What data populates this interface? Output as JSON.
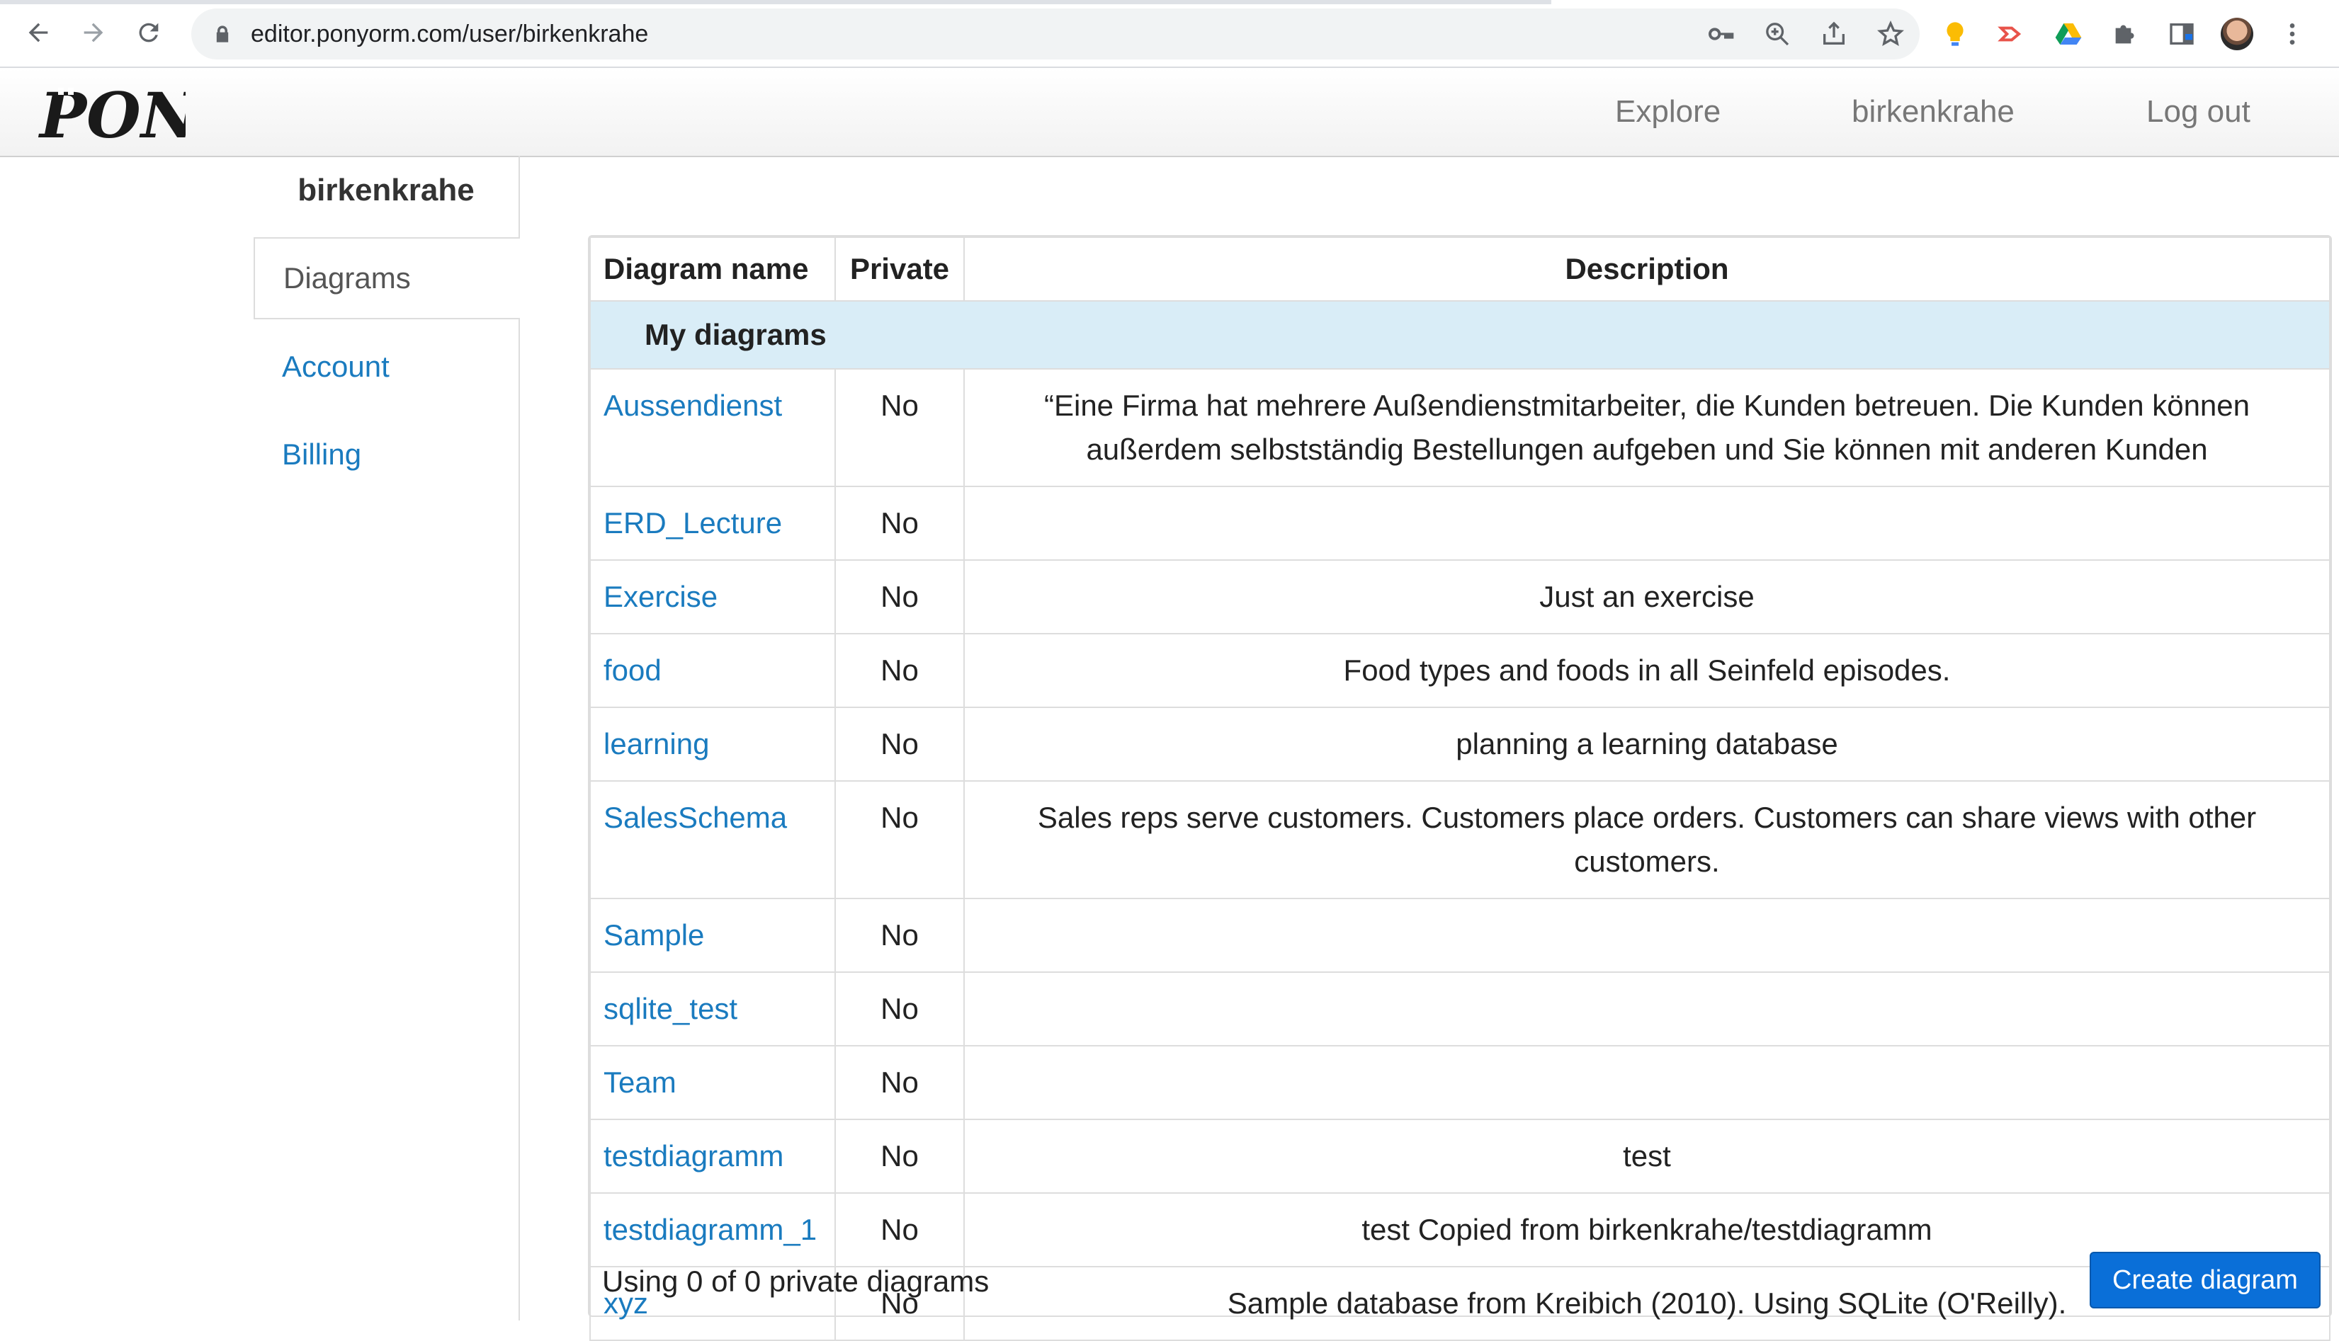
{
  "browser": {
    "url": "editor.ponyorm.com/user/birkenkrahe",
    "toolbar_icons": [
      "back-icon",
      "forward-icon",
      "reload-icon"
    ],
    "omnibox_icons": [
      "key-icon",
      "zoom-icon",
      "share-icon",
      "star-icon"
    ],
    "extension_icons": [
      "lightbulb-icon",
      "arrow-extension-icon",
      "drive-icon",
      "puzzle-icon",
      "sidepanel-icon",
      "profile-avatar",
      "menu-icon"
    ]
  },
  "header": {
    "logo_text": "PONY",
    "nav": {
      "explore": "Explore",
      "user": "birkenkrahe",
      "logout": "Log out"
    }
  },
  "sidebar": {
    "username": "birkenkrahe",
    "items": [
      {
        "label": "Diagrams",
        "active": true
      },
      {
        "label": "Account",
        "active": false
      },
      {
        "label": "Billing",
        "active": false
      }
    ]
  },
  "table": {
    "columns": [
      "Diagram name",
      "Private",
      "Description"
    ],
    "group_label": "My diagrams",
    "rows": [
      {
        "name": "Aussendienst",
        "private": "No",
        "description": "“Eine Firma hat mehrere Außendienstmitarbeiter, die Kunden betreuen. Die Kunden können außerdem selbstständig Bestellungen aufgeben und Sie können mit anderen Kunden"
      },
      {
        "name": "ERD_Lecture",
        "private": "No",
        "description": ""
      },
      {
        "name": "Exercise",
        "private": "No",
        "description": "Just an exercise"
      },
      {
        "name": "food",
        "private": "No",
        "description": "Food types and foods in all Seinfeld episodes."
      },
      {
        "name": "learning",
        "private": "No",
        "description": "planning a learning database"
      },
      {
        "name": "SalesSchema",
        "private": "No",
        "description": "Sales reps serve customers. Customers place orders. Customers can share views with other customers."
      },
      {
        "name": "Sample",
        "private": "No",
        "description": ""
      },
      {
        "name": "sqlite_test",
        "private": "No",
        "description": ""
      },
      {
        "name": "Team",
        "private": "No",
        "description": ""
      },
      {
        "name": "testdiagramm",
        "private": "No",
        "description": "test"
      },
      {
        "name": "testdiagramm_1",
        "private": "No",
        "description": "test Copied from birkenkrahe/testdiagramm"
      },
      {
        "name": "xyz",
        "private": "No",
        "description": "Sample database from Kreibich (2010). Using SQLite (O'Reilly)."
      }
    ],
    "usage_text": "Using 0 of 0 private diagrams",
    "create_button": "Create diagram"
  },
  "colors": {
    "link": "#1a7bbf",
    "group_row_bg": "#d9edf7",
    "primary_button": "#0a6fd8"
  }
}
